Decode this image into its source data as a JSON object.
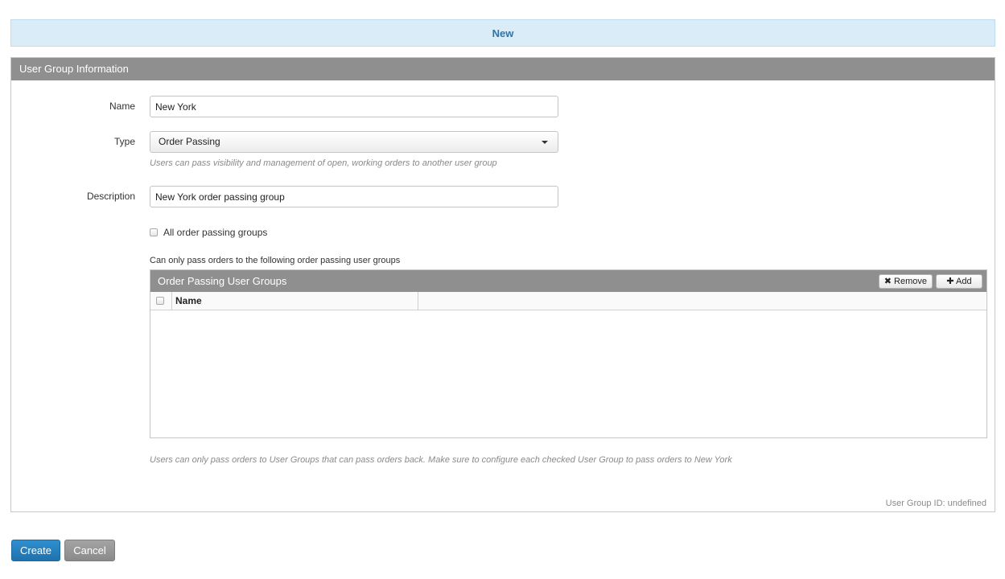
{
  "header": {
    "title": "New"
  },
  "panel": {
    "heading": "User Group Information",
    "name": {
      "label": "Name",
      "value": "New York"
    },
    "type": {
      "label": "Type",
      "selected": "Order Passing",
      "help": "Users can pass visibility and management of open, working orders to another user group"
    },
    "description": {
      "label": "Description",
      "value": "New York order passing group"
    },
    "all_groups_checkbox": {
      "label": "All order passing groups",
      "checked": false
    },
    "grid_intro": "Can only pass orders to the following order passing user groups",
    "grid": {
      "title": "Order Passing User Groups",
      "remove_label": "Remove",
      "add_label": "Add",
      "columns": [
        "Name"
      ],
      "rows": []
    },
    "footer_help": "Users can only pass orders to User Groups that can pass orders back. Make sure to configure each checked User Group to pass orders to New York",
    "group_id": "User Group ID: undefined"
  },
  "actions": {
    "create_label": "Create",
    "cancel_label": "Cancel"
  },
  "icons": {
    "remove": "x-icon",
    "add": "plus-icon",
    "select": "caret-down-icon"
  }
}
